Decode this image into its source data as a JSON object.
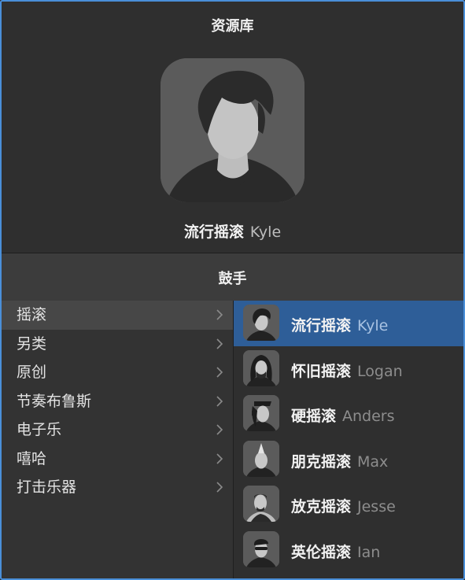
{
  "library": {
    "title": "资源库",
    "selected": {
      "style": "流行摇滚",
      "name": "Kyle"
    }
  },
  "section": {
    "title": "鼓手"
  },
  "categories": [
    {
      "label": "摇滚",
      "active": true
    },
    {
      "label": "另类"
    },
    {
      "label": "原创"
    },
    {
      "label": "节奏布鲁斯"
    },
    {
      "label": "电子乐"
    },
    {
      "label": "嘻哈"
    },
    {
      "label": "打击乐器"
    }
  ],
  "drummers": [
    {
      "style": "流行摇滚",
      "name": "Kyle",
      "active": true
    },
    {
      "style": "怀旧摇滚",
      "name": "Logan"
    },
    {
      "style": "硬摇滚",
      "name": "Anders"
    },
    {
      "style": "朋克摇滚",
      "name": "Max"
    },
    {
      "style": "放克摇滚",
      "name": "Jesse"
    },
    {
      "style": "英伦摇滚",
      "name": "Ian"
    }
  ],
  "colors": {
    "accent": "#2e5e98",
    "focus_ring": "#4a8fd9",
    "background": "#333333"
  },
  "icons": {
    "chevron": "chevron-right-icon",
    "avatar": "drummer-avatar-icon"
  }
}
